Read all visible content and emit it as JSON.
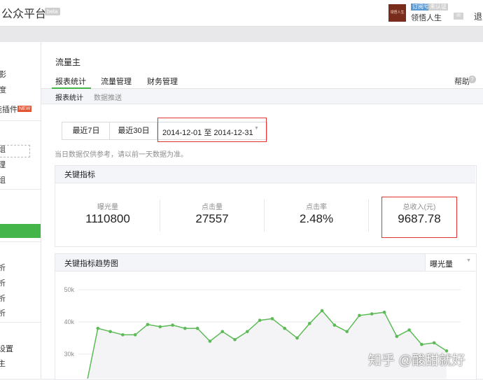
{
  "header": {
    "brand": "公众平台",
    "beta": "beta",
    "avatar_text": "领悟人生",
    "badge_subscription": "订阅号",
    "badge_verify": "未认证",
    "username": "领悟人生",
    "mail_icon": "envelope-icon",
    "logout": "退"
  },
  "sidebar": {
    "items": [
      {
        "label": "影",
        "active": false
      },
      {
        "label": "度",
        "active": false
      },
      {
        "label": "能插件",
        "active": false,
        "badge": "NEW"
      },
      {
        "label": "组",
        "active": false
      },
      {
        "label": "理",
        "active": false
      },
      {
        "label": "组",
        "active": false
      },
      {
        "label": "",
        "active": true
      },
      {
        "label": "析",
        "active": false
      },
      {
        "label": "析",
        "active": false
      },
      {
        "label": "析",
        "active": false
      },
      {
        "label": "析",
        "active": false
      },
      {
        "label": "设置",
        "active": false
      },
      {
        "label": "主",
        "active": false
      }
    ],
    "active_color": "#44b549"
  },
  "main": {
    "section_title": "流量主",
    "tabs": [
      {
        "label": "报表统计",
        "active": true
      },
      {
        "label": "流量管理",
        "active": false
      },
      {
        "label": "财务管理",
        "active": false
      }
    ],
    "help": "帮助",
    "help_icon": "question-icon",
    "subtabs": [
      {
        "label": "报表统计",
        "active": true
      },
      {
        "label": "数据推送",
        "active": false
      }
    ],
    "date_buttons": {
      "last7": "最近7日",
      "last30": "最近30日",
      "range": "2014-12-01 至 2014-12-31"
    },
    "notice": "当日数据仅供参考，请以前一天数据为准。",
    "kpi": {
      "title": "关键指标",
      "items": [
        {
          "label": "曝光量",
          "value": "1110800"
        },
        {
          "label": "点击量",
          "value": "27557"
        },
        {
          "label": "点击率",
          "value": "2.48%"
        },
        {
          "label": "总收入(元)",
          "value": "9687.78"
        }
      ]
    },
    "trend": {
      "title": "关键指标趋势图",
      "metric": "曝光量"
    }
  },
  "chart_data": {
    "type": "line",
    "series": [
      {
        "values": [
          19000,
          38000,
          37000,
          36000,
          36000,
          39200,
          38500,
          39000,
          38000,
          38000,
          34000,
          37000,
          34500,
          37000,
          40500,
          41000,
          38000,
          35000,
          39500,
          43500,
          39000,
          37000,
          42000,
          42500,
          43000,
          35500,
          37500,
          33000,
          33500,
          31000
        ]
      }
    ],
    "yticks": [
      "50k",
      "40k",
      "30k"
    ],
    "ylim_visible": [
      26000,
      52000
    ],
    "grid": true,
    "line_color": "#5cbb57",
    "fill_color": "#f4f4f6"
  },
  "watermark": "知乎 @酸甜就好",
  "colors": {
    "accent": "#44b549",
    "highlight_border": "#e03636"
  }
}
